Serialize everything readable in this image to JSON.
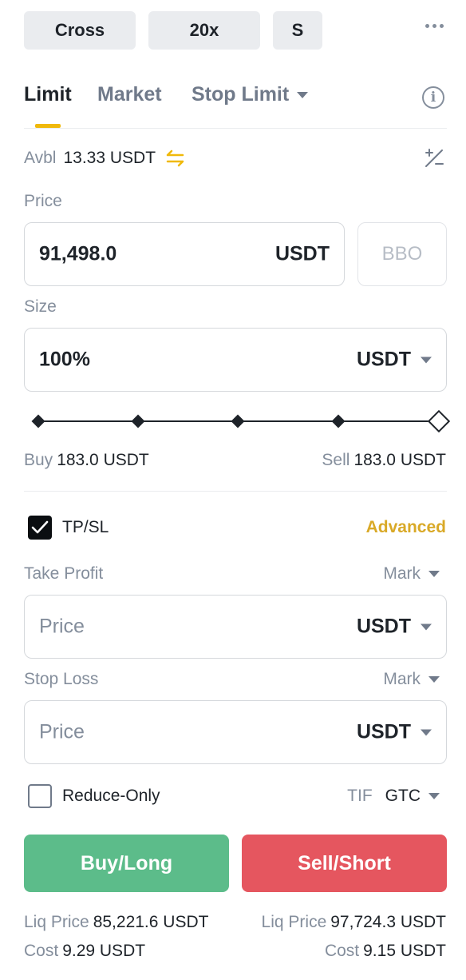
{
  "top_bar": {
    "margin_mode": "Cross",
    "leverage": "20x",
    "position_mode": "S",
    "more_icon": "more-horizontal-icon"
  },
  "order_tabs": [
    {
      "label": "Limit",
      "active": true
    },
    {
      "label": "Market",
      "active": false
    },
    {
      "label": "Stop Limit",
      "active": false
    }
  ],
  "available": {
    "label": "Avbl",
    "value": "13.33 USDT",
    "transfer_icon": "transfer-arrows-icon",
    "calculator_icon": "calculator-icon"
  },
  "price": {
    "label": "Price",
    "value": "91,498.0",
    "unit": "USDT",
    "bbo_label": "BBO"
  },
  "size": {
    "label": "Size",
    "value": "100%",
    "unit": "USDT",
    "slider_percent": 100
  },
  "buy_sell_amounts": {
    "buy_label": "Buy",
    "buy_value": "183.0 USDT",
    "sell_label": "Sell",
    "sell_value": "183.0 USDT"
  },
  "tpsl": {
    "label": "TP/SL",
    "checked": true,
    "advanced_label": "Advanced"
  },
  "take_profit": {
    "label": "Take Profit",
    "trigger": "Mark",
    "placeholder": "Price",
    "unit": "USDT"
  },
  "stop_loss": {
    "label": "Stop Loss",
    "trigger": "Mark",
    "placeholder": "Price",
    "unit": "USDT"
  },
  "reduce_only": {
    "label": "Reduce-Only",
    "checked": false,
    "tif_label": "TIF",
    "tif_value": "GTC"
  },
  "actions": {
    "buy_label": "Buy/Long",
    "sell_label": "Sell/Short"
  },
  "buy_summary": {
    "liq_label": "Liq Price",
    "liq_value": "85,221.6 USDT",
    "cost_label": "Cost",
    "cost_value": "9.29 USDT"
  },
  "sell_summary": {
    "liq_label": "Liq Price",
    "liq_value": "97,724.3 USDT",
    "cost_label": "Cost",
    "cost_value": "9.15 USDT"
  },
  "colors": {
    "accent": "#f0b90b",
    "buy": "#5cbc8a",
    "sell": "#e5565f",
    "advanced": "#d9a927"
  }
}
